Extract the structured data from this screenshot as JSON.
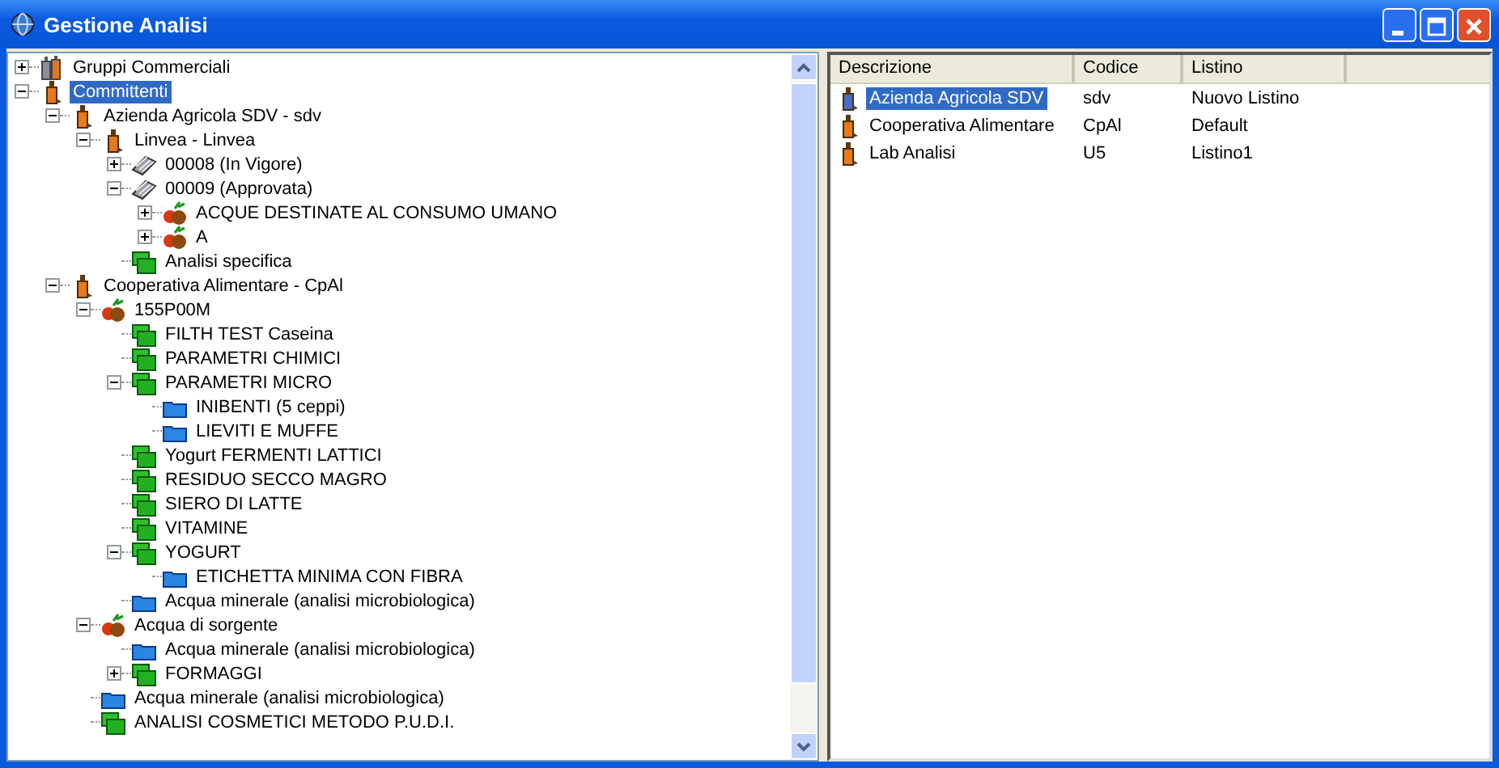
{
  "window": {
    "title": "Gestione Analisi"
  },
  "tree": [
    {
      "label": "Gruppi Commerciali",
      "kind": "group",
      "expanded": false,
      "selected": false
    },
    {
      "label": "Committenti",
      "kind": "client",
      "expanded": true,
      "selected": true,
      "children": [
        {
          "label": "Azienda Agricola SDV - sdv",
          "kind": "client",
          "expanded": true,
          "selected": false,
          "children": [
            {
              "label": "Linvea - Linvea",
              "kind": "client",
              "expanded": true,
              "selected": false,
              "children": [
                {
                  "label": "00008 (In Vigore)",
                  "kind": "pricelist",
                  "expanded": false,
                  "selected": false
                },
                {
                  "label": "00009 (Approvata)",
                  "kind": "pricelist",
                  "expanded": true,
                  "selected": false,
                  "children": [
                    {
                      "label": "ACQUE DESTINATE AL CONSUMO UMANO",
                      "kind": "fruit",
                      "expanded": false,
                      "selected": false
                    },
                    {
                      "label": "A",
                      "kind": "fruit",
                      "expanded": false,
                      "selected": false
                    }
                  ]
                },
                {
                  "label": "Analisi specifica",
                  "kind": "green-folder",
                  "selected": false
                }
              ]
            }
          ]
        },
        {
          "label": "Cooperativa Alimentare - CpAl",
          "kind": "client",
          "expanded": true,
          "selected": false,
          "children": [
            {
              "label": "155P00M",
              "kind": "fruit",
              "expanded": true,
              "selected": false,
              "children": [
                {
                  "label": "FILTH TEST Caseina",
                  "kind": "green-folder",
                  "selected": false
                },
                {
                  "label": "PARAMETRI CHIMICI",
                  "kind": "green-folder",
                  "selected": false
                },
                {
                  "label": "PARAMETRI MICRO",
                  "kind": "green-folder",
                  "expanded": true,
                  "selected": false,
                  "children": [
                    {
                      "label": "INIBENTI (5 ceppi)",
                      "kind": "blue-folder",
                      "selected": false
                    },
                    {
                      "label": "LIEVITI E MUFFE",
                      "kind": "blue-folder",
                      "selected": false
                    }
                  ]
                },
                {
                  "label": " Yogurt FERMENTI LATTICI",
                  "kind": "green-folder",
                  "selected": false
                },
                {
                  "label": "RESIDUO SECCO MAGRO",
                  "kind": "green-folder",
                  "selected": false
                },
                {
                  "label": "SIERO DI LATTE",
                  "kind": "green-folder",
                  "selected": false
                },
                {
                  "label": "VITAMINE",
                  "kind": "green-folder",
                  "selected": false
                },
                {
                  "label": "YOGURT",
                  "kind": "green-folder",
                  "expanded": true,
                  "selected": false,
                  "children": [
                    {
                      "label": "ETICHETTA MINIMA CON FIBRA",
                      "kind": "blue-folder",
                      "selected": false
                    }
                  ]
                },
                {
                  "label": "Acqua minerale (analisi microbiologica)",
                  "kind": "blue-folder",
                  "selected": false
                }
              ]
            },
            {
              "label": "Acqua di sorgente",
              "kind": "fruit",
              "expanded": true,
              "selected": false,
              "children": [
                {
                  "label": "Acqua minerale (analisi microbiologica)",
                  "kind": "blue-folder",
                  "selected": false
                },
                {
                  "label": "FORMAGGI",
                  "kind": "green-folder",
                  "expanded": false,
                  "selected": false
                }
              ]
            },
            {
              "label": "Acqua minerale (analisi microbiologica)",
              "kind": "blue-folder",
              "selected": false
            },
            {
              "label": "ANALISI COSMETICI METODO P.U.D.I.",
              "kind": "green-folder",
              "selected": false
            }
          ]
        }
      ]
    }
  ],
  "list": {
    "columns": [
      "Descrizione",
      "Codice",
      "Listino"
    ],
    "rows": [
      {
        "cells": [
          "Azienda Agricola SDV",
          "sdv",
          "Nuovo Listino"
        ],
        "selected": true
      },
      {
        "cells": [
          "Cooperativa Alimentare",
          "CpAl",
          "Default"
        ],
        "selected": false
      },
      {
        "cells": [
          "Lab Analisi",
          "U5",
          "Listino1"
        ],
        "selected": false
      }
    ]
  }
}
